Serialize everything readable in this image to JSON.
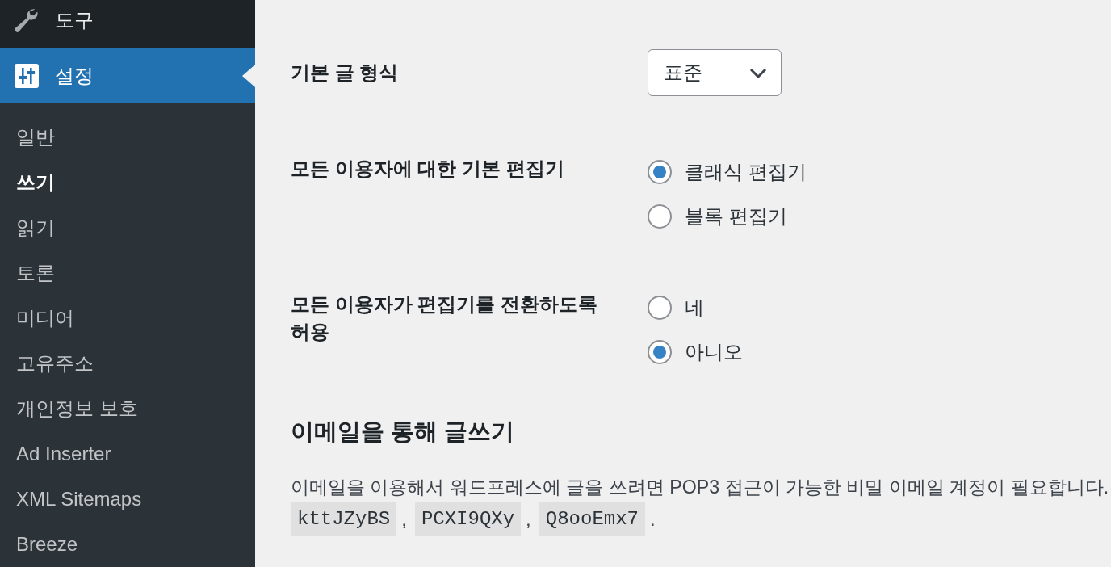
{
  "menu": [
    {
      "label": "도구",
      "selected": false
    },
    {
      "label": "설정",
      "selected": true,
      "submenu": [
        {
          "label": "일반",
          "selected": false
        },
        {
          "label": "쓰기",
          "selected": true
        },
        {
          "label": "읽기",
          "selected": false
        },
        {
          "label": "토론",
          "selected": false
        },
        {
          "label": "미디어",
          "selected": false
        },
        {
          "label": "고유주소",
          "selected": false
        },
        {
          "label": "개인정보 보호",
          "selected": false
        },
        {
          "label": "Ad Inserter",
          "selected": false
        },
        {
          "label": "XML Sitemaps",
          "selected": false
        },
        {
          "label": "Breeze",
          "selected": false
        }
      ]
    }
  ],
  "settings": [
    {
      "kind": "select",
      "label": "기본 글 형식",
      "value": "표준"
    },
    {
      "kind": "radio",
      "label": "모든 이용자에 대한 기본 편집기",
      "options": [
        {
          "label": "클래식 편집기",
          "selected": true
        },
        {
          "label": "블록 편집기",
          "selected": false
        }
      ]
    },
    {
      "kind": "radio",
      "label": "모든 이용자가 편집기를 전환하도록 허용",
      "options": [
        {
          "label": "네",
          "selected": false
        },
        {
          "label": "아니오",
          "selected": true
        }
      ]
    }
  ],
  "post_via_email": {
    "heading": "이메일을 통해 글쓰기",
    "description": "이메일을 이용해서 워드프레스에 글을 쓰려면 POP3 접근이 가능한 비밀 이메일 계정이 필요합니다.",
    "code_line": [
      {
        "kind": "code",
        "text": "kttJZyBS"
      },
      {
        "kind": "separator",
        "text": ","
      },
      {
        "kind": "code",
        "text": "PCXI9QXy"
      },
      {
        "kind": "separator",
        "text": ","
      },
      {
        "kind": "code",
        "text": "Q8ooEmx7"
      },
      {
        "kind": "separator",
        "text": "."
      }
    ]
  }
}
